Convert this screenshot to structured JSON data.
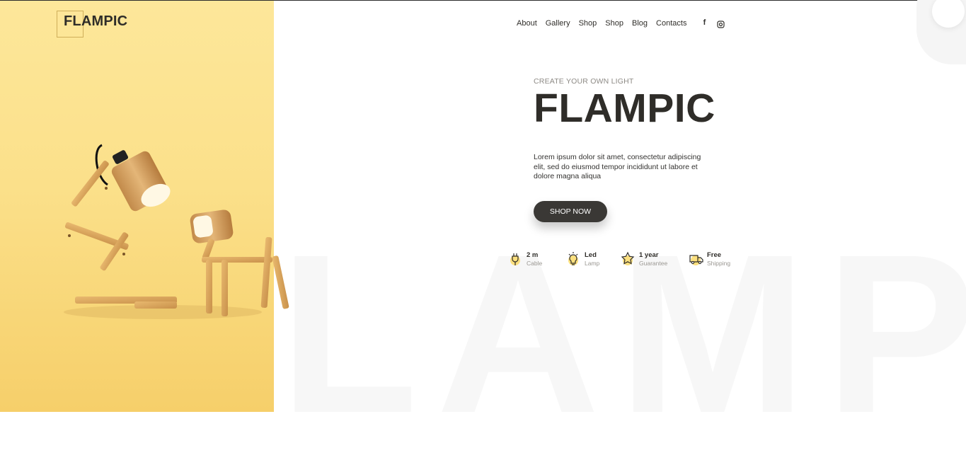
{
  "brand": {
    "logo": "FLAMPIC"
  },
  "nav": {
    "items": [
      {
        "label": "About"
      },
      {
        "label": "Gallery"
      },
      {
        "label": "Shop"
      },
      {
        "label": "Shop"
      },
      {
        "label": "Blog"
      },
      {
        "label": "Contacts"
      }
    ]
  },
  "social": [
    {
      "icon": "facebook-icon",
      "glyph": "f"
    },
    {
      "icon": "instagram-icon"
    }
  ],
  "hero": {
    "subtitle": "CREATE YOUR OWN LIGHT",
    "title": "FLAMPIC",
    "description": "Lorem ipsum dolor sit amet, consectetur adipiscing elit, sed do eiusmod tempor incididunt ut labore et dolore magna aliqua",
    "cta": "SHOP NOW"
  },
  "features": [
    {
      "icon": "plug-icon",
      "title": "2 m",
      "sub": "Cable"
    },
    {
      "icon": "bulb-icon",
      "title": "Led",
      "sub": "Lamp"
    },
    {
      "icon": "star-icon",
      "title": "1 year",
      "sub": "Guarantee"
    },
    {
      "icon": "truck-icon",
      "title": "Free",
      "sub": "Shipping"
    }
  ],
  "background_word": "LAMP",
  "colors": {
    "accent_yellow": "#fbe08a",
    "dark": "#3a3835",
    "wood": "#d9a45a"
  }
}
